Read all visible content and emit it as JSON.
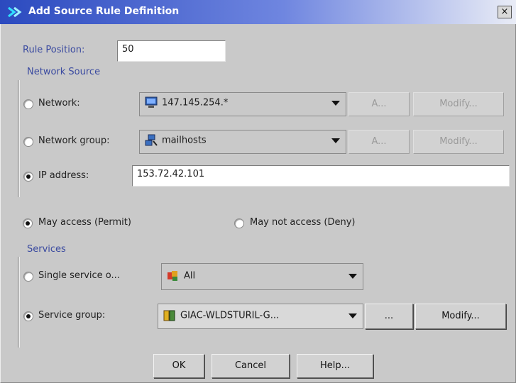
{
  "window": {
    "title": "Add Source Rule Definition",
    "close_glyph": "×"
  },
  "rule_position": {
    "label": "Rule Position:",
    "value": "50"
  },
  "network_source": {
    "title": "Network Source",
    "network": {
      "label": "Network:",
      "value": "147.145.254.*",
      "icon": "network-computer-icon",
      "add_label": "A...",
      "modify_label": "Modify...",
      "selected": false
    },
    "network_group": {
      "label": "Network group:",
      "value": "mailhosts",
      "icon": "host-group-icon",
      "add_label": "A...",
      "modify_label": "Modify...",
      "selected": false
    },
    "ip_address": {
      "label": "IP address:",
      "value": "153.72.42.101",
      "selected": true
    }
  },
  "access": {
    "permit_label": "May access (Permit)",
    "deny_label": "May not access (Deny)",
    "selected": "permit"
  },
  "services": {
    "title": "Services",
    "single_service": {
      "label": "Single service o...",
      "value": "All",
      "icon": "service-all-icon",
      "selected": false
    },
    "service_group": {
      "label": "Service group:",
      "value": "GIAC-WLDSTURIL-G...",
      "icon": "service-group-icon",
      "browse_label": "...",
      "modify_label": "Modify...",
      "selected": true
    }
  },
  "footer": {
    "ok_label": "OK",
    "cancel_label": "Cancel",
    "help_label": "Help..."
  },
  "colors": {
    "title_bar_start": "#2b4abf",
    "dialog_bg": "#c9c9c9",
    "section_title": "#3a4aa0"
  }
}
